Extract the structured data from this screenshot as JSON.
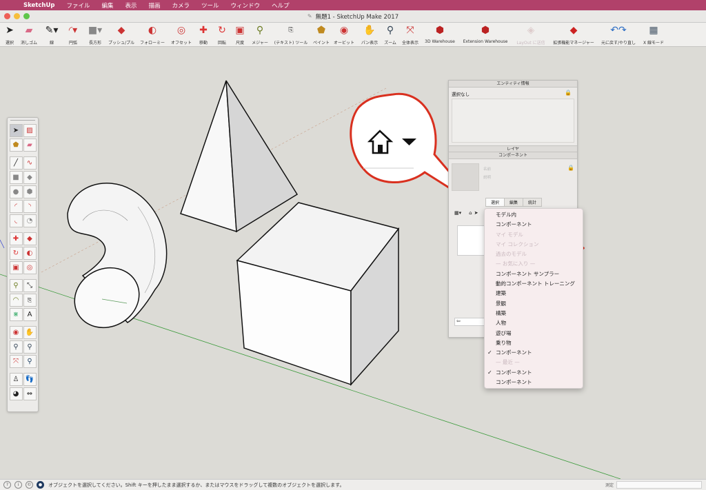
{
  "menubar": {
    "apple_icon": "apple-icon",
    "items": [
      "SketchUp",
      "ファイル",
      "編集",
      "表示",
      "描画",
      "カメラ",
      "ツール",
      "ウィンドウ",
      "ヘルプ"
    ]
  },
  "window": {
    "title": "無題1 - SketchUp Make 2017"
  },
  "toolbar": {
    "items": [
      {
        "label": "選択",
        "icon": "select-arrow-icon"
      },
      {
        "label": "消しゴム",
        "icon": "eraser-icon"
      },
      {
        "label": "線",
        "icon": "line-pencil-icon"
      },
      {
        "label": "円弧",
        "icon": "arc-icon"
      },
      {
        "label": "長方形",
        "icon": "rectangle-icon"
      },
      {
        "label": "プッシュ/プル",
        "icon": "push-pull-icon"
      },
      {
        "label": "フォローミー",
        "icon": "follow-me-icon"
      },
      {
        "label": "オフセット",
        "icon": "offset-icon"
      },
      {
        "label": "移動",
        "icon": "move-icon"
      },
      {
        "label": "回転",
        "icon": "rotate-icon"
      },
      {
        "label": "尺度",
        "icon": "scale-icon"
      },
      {
        "label": "メジャー",
        "icon": "tape-measure-icon"
      },
      {
        "label": "(テキスト) ツール",
        "icon": "text-tool-icon"
      },
      {
        "label": "ペイント",
        "icon": "paint-bucket-icon"
      },
      {
        "label": "オービット",
        "icon": "orbit-icon"
      },
      {
        "label": "パン表示",
        "icon": "pan-icon"
      },
      {
        "label": "ズーム",
        "icon": "zoom-icon"
      },
      {
        "label": "全体表示",
        "icon": "zoom-extents-icon"
      },
      {
        "label": "3D Warehouse",
        "icon": "3d-warehouse-icon"
      },
      {
        "label": "Extension Warehouse",
        "icon": "extension-warehouse-icon"
      },
      {
        "label": "LayOut に送信",
        "icon": "layout-send-icon",
        "disabled": true
      },
      {
        "label": "拡張機能マネージャー",
        "icon": "extension-manager-icon"
      },
      {
        "label": "元に戻す/やり直し",
        "icon": "undo-redo-icon"
      },
      {
        "label": "X 線モード",
        "icon": "xray-icon"
      }
    ]
  },
  "palette": {
    "rows": [
      [
        "select-arrow-icon",
        "make-component-icon"
      ],
      [
        "paint-bucket-icon",
        "eraser-icon"
      ],
      [
        "line-pencil-icon",
        "freehand-icon"
      ],
      [
        "rectangle-icon",
        "rotated-rectangle-icon"
      ],
      [
        "circle-icon",
        "polygon-icon"
      ],
      [
        "arc-icon",
        "two-point-arc-icon"
      ],
      [
        "three-point-arc-icon",
        "pie-icon"
      ],
      [
        "move-icon",
        "push-pull-icon"
      ],
      [
        "rotate-icon",
        "follow-me-icon"
      ],
      [
        "scale-icon",
        "offset-icon"
      ],
      [
        "tape-measure-icon",
        "dimension-icon"
      ],
      [
        "protractor-icon",
        "text-tool-icon"
      ],
      [
        "axes-icon",
        "3d-text-icon"
      ],
      [
        "orbit-icon",
        "pan-icon"
      ],
      [
        "zoom-icon",
        "zoom-window-icon"
      ],
      [
        "zoom-extents-icon",
        "previous-view-icon"
      ],
      [
        "position-camera-icon",
        "walk-icon"
      ],
      [
        "look-around-icon",
        "section-plane-icon"
      ]
    ]
  },
  "entity_panel": {
    "title": "エンティティ情報",
    "selection_text": "選択なし"
  },
  "layer_panel": {
    "title": "レイヤ"
  },
  "components_panel": {
    "title": "コンポーネント",
    "name_placeholder": "名前",
    "desc_placeholder": "説明",
    "tabs": [
      "選択",
      "編集",
      "統計"
    ],
    "active_tab": "選択"
  },
  "dropdown": {
    "items": [
      {
        "label": "モデル内",
        "disabled": false,
        "checked": false
      },
      {
        "label": "コンポーネント",
        "disabled": false,
        "checked": false
      },
      {
        "label": "マイ モデル",
        "disabled": true,
        "checked": false
      },
      {
        "label": "マイ コレクション",
        "disabled": true,
        "checked": false
      },
      {
        "label": "過去のモデル",
        "disabled": true,
        "checked": false
      },
      {
        "label": "— お気に入り —",
        "disabled": true,
        "checked": false
      },
      {
        "label": "コンポーネント サンプラー",
        "disabled": false,
        "checked": false
      },
      {
        "label": "動的コンポーネント トレーニング",
        "disabled": false,
        "checked": false
      },
      {
        "label": "建築",
        "disabled": false,
        "checked": false
      },
      {
        "label": "景観",
        "disabled": false,
        "checked": false
      },
      {
        "label": "構築",
        "disabled": false,
        "checked": false
      },
      {
        "label": "人物",
        "disabled": false,
        "checked": false
      },
      {
        "label": "遊び場",
        "disabled": false,
        "checked": false
      },
      {
        "label": "乗り物",
        "disabled": false,
        "checked": false
      },
      {
        "label": "コンポーネント",
        "disabled": false,
        "checked": true
      },
      {
        "label": "— 最近 —",
        "disabled": true,
        "checked": false
      },
      {
        "label": "コンポーネント",
        "disabled": false,
        "checked": true
      },
      {
        "label": "コンポーネント",
        "disabled": false,
        "checked": false
      }
    ]
  },
  "status": {
    "message": "オブジェクトを選択してください。Shift キーを押したまま選択するか、またはマウスをドラッグして複数のオブジェクトを選択します。",
    "measure_label": "測定"
  },
  "colors": {
    "menubar": "#b1416a",
    "accent_red": "#d9301f",
    "axis_green": "#3a9a3a",
    "axis_red": "#c65a4a"
  }
}
